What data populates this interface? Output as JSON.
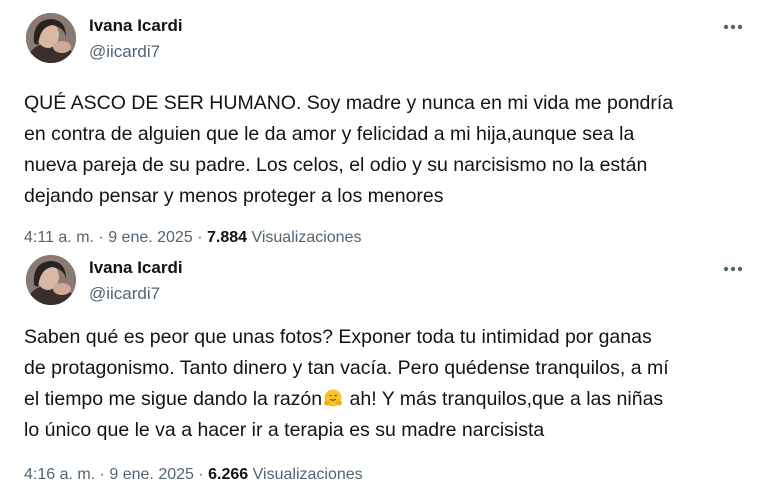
{
  "tweets": [
    {
      "author_name": "Ivana Icardi",
      "handle": "@iicardi7",
      "text": "QUÉ ASCO DE SER HUMANO. Soy madre y nunca en mi vida me pondría\nen contra de alguien que le da amor y felicidad a mi hija,aunque sea la\nnueva pareja de su padre. Los celos, el odio y su narcisismo no la están\ndejando pensar y menos proteger a los menores",
      "time": "4:11 a. m.",
      "date": "9 ene. 2025",
      "views_count": "7.884",
      "views_label": "Visualizaciones",
      "separator": "·",
      "more_icon": "more-horizontal-icon"
    },
    {
      "author_name": "Ivana Icardi",
      "handle": "@iicardi7",
      "text_before_emoji": "Saben qué es peor que unas fotos? Exponer toda tu intimidad por ganas\nde protagonismo. Tanto dinero y tan vacía. Pero quédense tranquilos, a mí\nel tiempo me sigue dando la razón",
      "emoji": "hugging-face-emoji",
      "text_after_emoji": " ah! Y más tranquilos,que a las niñas\nlo único que le va a hacer ir a terapia es su madre narcisista",
      "time": "4:16 a. m.",
      "date": "9 ene. 2025",
      "views_count": "6.266",
      "views_label": "Visualizaciones",
      "separator": "·",
      "more_icon": "more-horizontal-icon"
    }
  ],
  "colors": {
    "text_primary": "#0f1419",
    "text_secondary": "#536471",
    "background": "#ffffff"
  }
}
